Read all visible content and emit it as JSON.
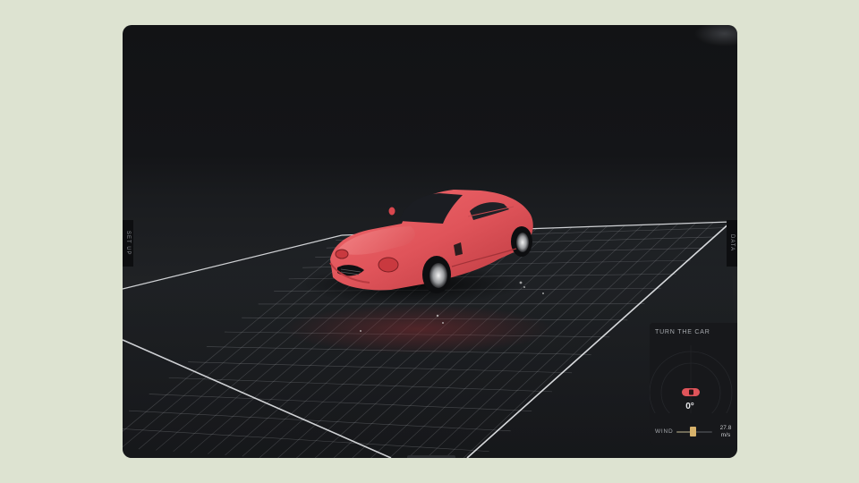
{
  "tabs": {
    "left_label": "SET UP",
    "right_label": "DATA"
  },
  "panel": {
    "title": "TURN THE CAR",
    "angle": "0°",
    "wind_label": "WIND",
    "wind_value": "27.8",
    "wind_unit": "m/s",
    "wind_level": 0.45
  },
  "colors": {
    "car": "#e0545a",
    "accent": "#d7b16a",
    "grid": "#d7d9dc",
    "page_background": "#dde3d1"
  }
}
